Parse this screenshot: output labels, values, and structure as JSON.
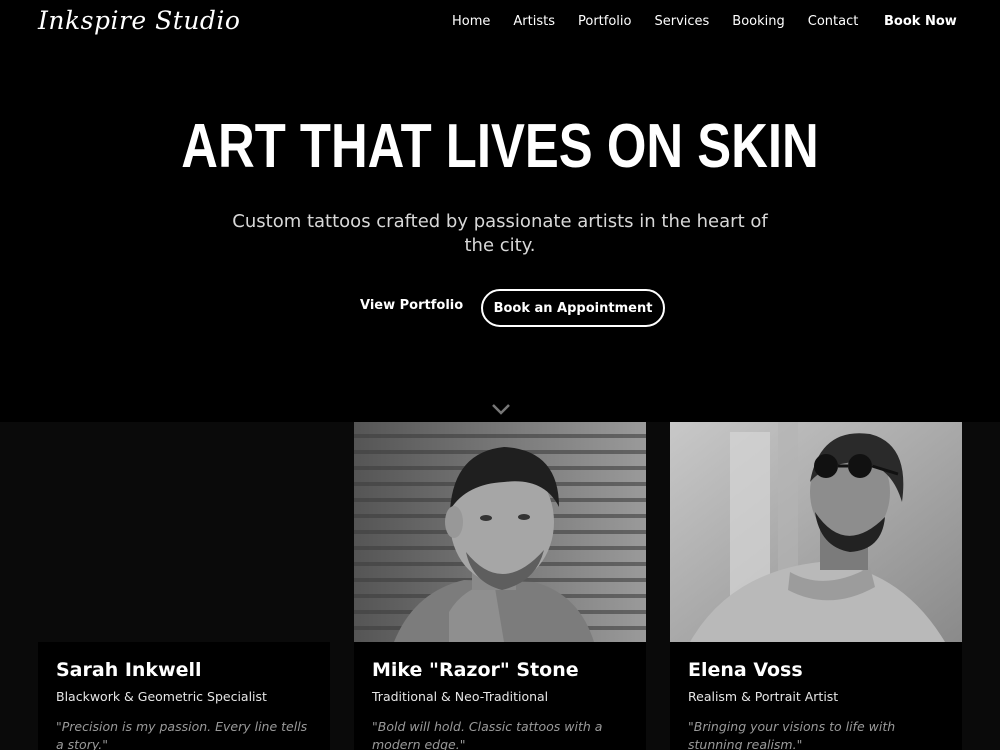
{
  "nav": {
    "logo": "Inkspire Studio",
    "links": [
      "Home",
      "Artists",
      "Portfolio",
      "Services",
      "Booking",
      "Contact"
    ],
    "cta": "Book Now"
  },
  "hero": {
    "title": "ART THAT LIVES ON SKIN",
    "subtitle": "Custom tattoos crafted by passionate artists in the heart of the city.",
    "primary_button": "View Portfolio",
    "secondary_button": "Book an Appointment",
    "scroll_icon": "chevron-down-icon"
  },
  "artists": [
    {
      "name": "Sarah Inkwell",
      "specialty": "Blackwork & Geometric Specialist",
      "quote": "\"Precision is my passion. Every line tells a story.\""
    },
    {
      "name": "Mike \"Razor\" Stone",
      "specialty": "Traditional & Neo-Traditional",
      "quote": "\"Bold will hold. Classic tattoos with a modern edge.\""
    },
    {
      "name": "Elena Voss",
      "specialty": "Realism & Portrait Artist",
      "quote": "\"Bringing your visions to life with stunning realism.\""
    }
  ],
  "colors": {
    "background": "#000000",
    "section_background": "#0a0a0a",
    "text": "#ffffff",
    "muted": "#9a9a9a"
  }
}
